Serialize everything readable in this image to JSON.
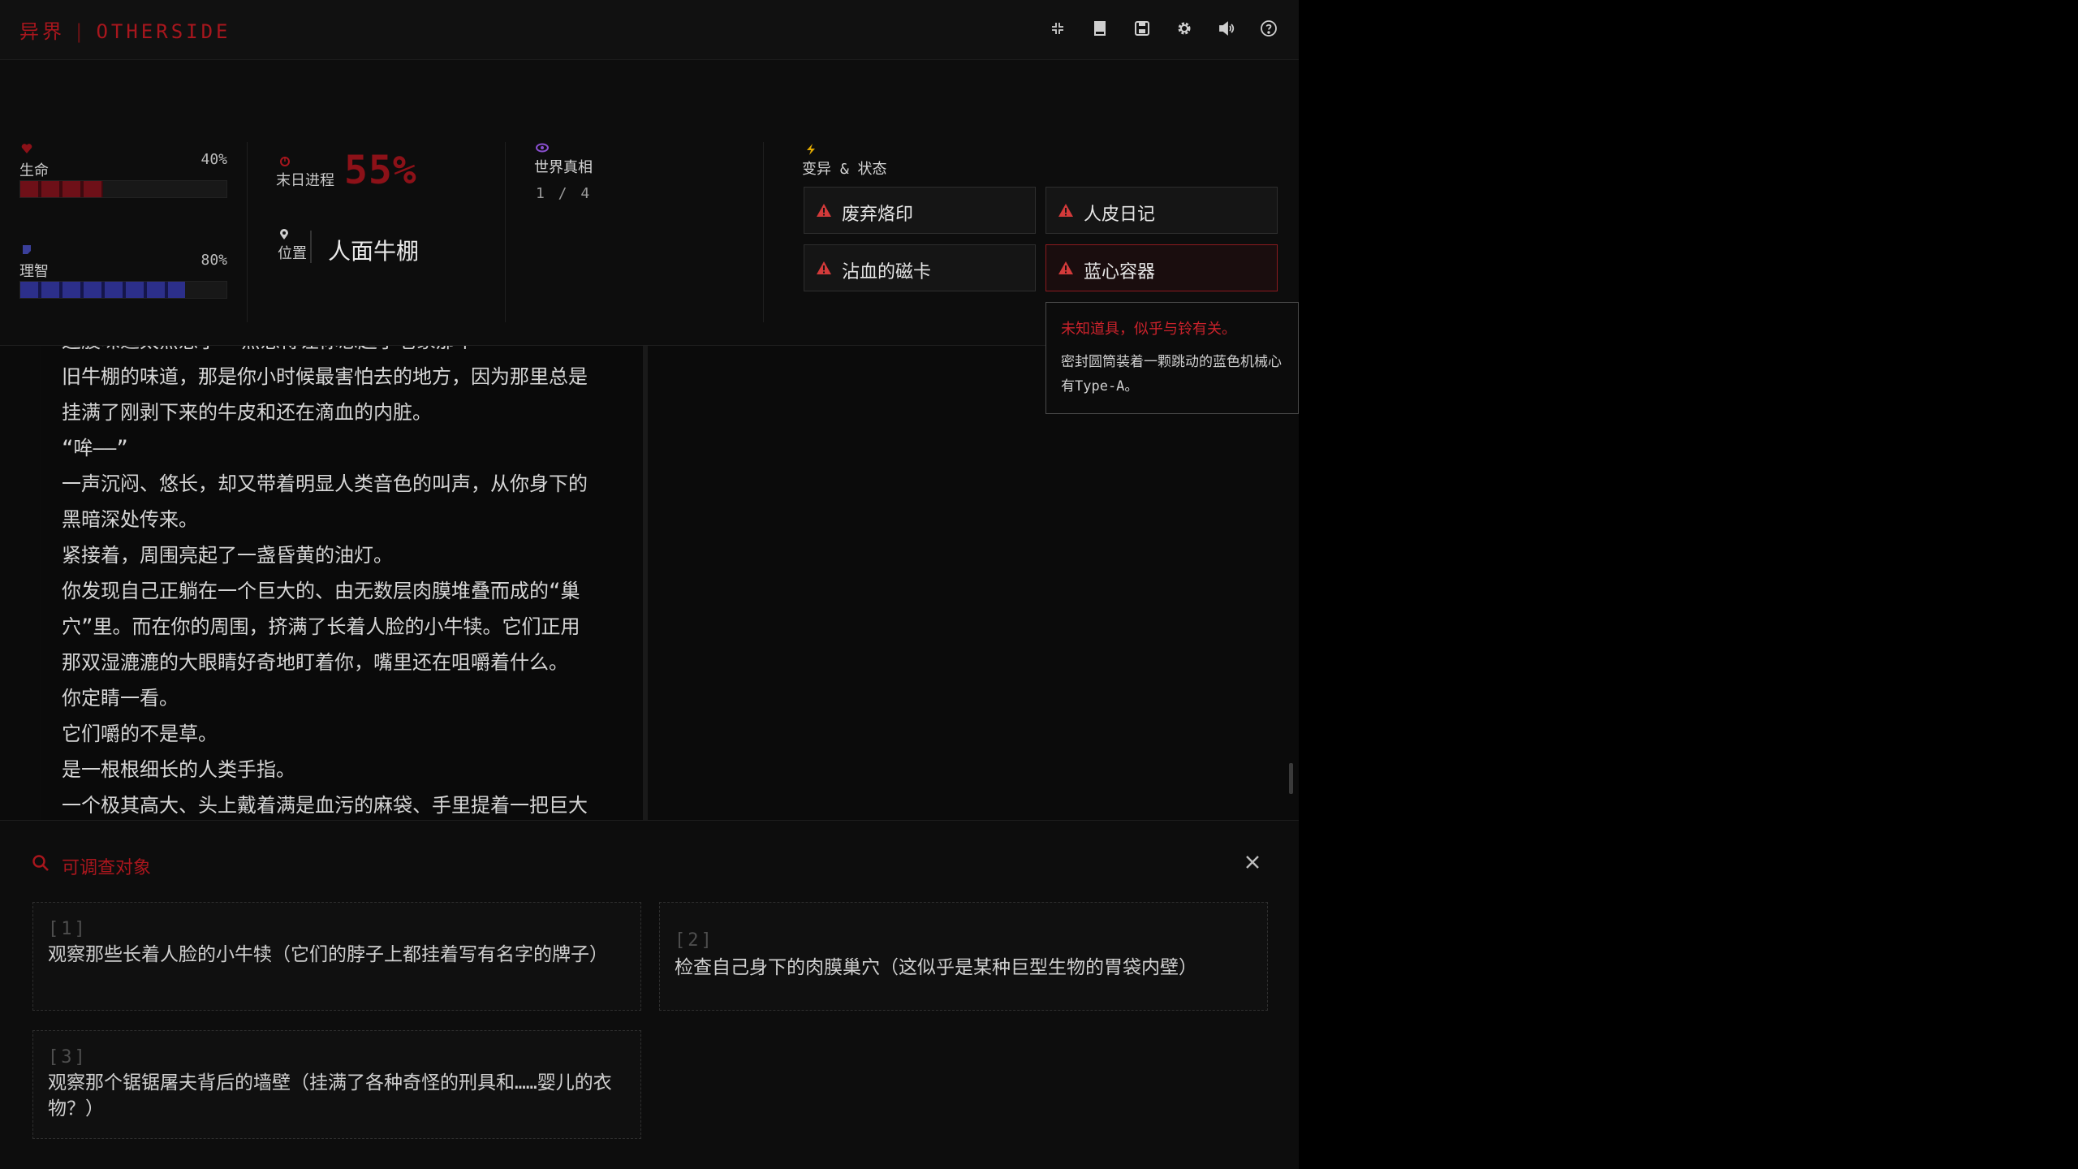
{
  "app": {
    "brand_cn": "异界",
    "brand_sep": "|",
    "brand_en": "OTHERSIDE"
  },
  "toolbar": {
    "icons": [
      "collapse-icon",
      "journal-icon",
      "save-icon",
      "settings-icon",
      "volume-icon",
      "help-icon"
    ]
  },
  "stats": {
    "life": {
      "label": "生命",
      "percent_label": "40%",
      "value": 40,
      "color": "#6e1018"
    },
    "sanity": {
      "label": "理智",
      "percent_label": "80%",
      "value": 80,
      "color": "#2c2f8a"
    },
    "doom": {
      "label": "末日进程",
      "value": "55%"
    },
    "location": {
      "label": "位置",
      "name": "人面牛棚"
    }
  },
  "truth": {
    "label": "世界真相",
    "count": "1 / 4"
  },
  "mutations": {
    "label": "变异 & 状态",
    "items": [
      {
        "name": "废弃烙印",
        "active": false
      },
      {
        "name": "人皮日记",
        "active": false
      },
      {
        "name": "沾血的磁卡",
        "active": false
      },
      {
        "name": "蓝心容器",
        "active": true
      }
    ]
  },
  "tooltip": {
    "title": "未知道具，似乎与铃有关。",
    "desc_line1": "密封圆筒装着一颗跳动的蓝色机械心",
    "desc_line2": "有Type-A。"
  },
  "story": {
    "lines": [
      "这股味道太熟悉了——熟悉得让你想起了老家那个",
      "旧牛棚的味道，那是你小时候最害怕去的地方，因为那里总是",
      "挂满了刚剥下来的牛皮和还在滴血的内脏。",
      "“哞——”",
      "一声沉闷、悠长，却又带着明显人类音色的叫声，从你身下的",
      "黑暗深处传来。",
      "紧接着，周围亮起了一盏昏黄的油灯。",
      "你发现自己正躺在一个巨大的、由无数层肉膜堆叠而成的“巢",
      "穴”里。而在你的周围，挤满了长着人脸的小牛犊。它们正用",
      "那双湿漉漉的大眼睛好奇地盯着你，嘴里还在咀嚼着什么。",
      "你定睛一看。",
      "它们嚼的不是草。",
      "是一根根细长的人类手指。",
      "一个极其高大、头上戴着满是血污的麻袋、手里提着一把巨大"
    ]
  },
  "investigate": {
    "title": "可调查对象",
    "options": [
      {
        "num": "[1]",
        "text": "观察那些长着人脸的小牛犊（它们的脖子上都挂着写有名字的牌子）"
      },
      {
        "num": "[2]",
        "text": "检查自己身下的肉膜巢穴（这似乎是某种巨型生物的胃袋内壁）"
      },
      {
        "num": "[3]",
        "text": "观察那个锯锯屠夫背后的墙壁（挂满了各种奇怪的刑具和……婴儿的衣物？）"
      }
    ]
  }
}
